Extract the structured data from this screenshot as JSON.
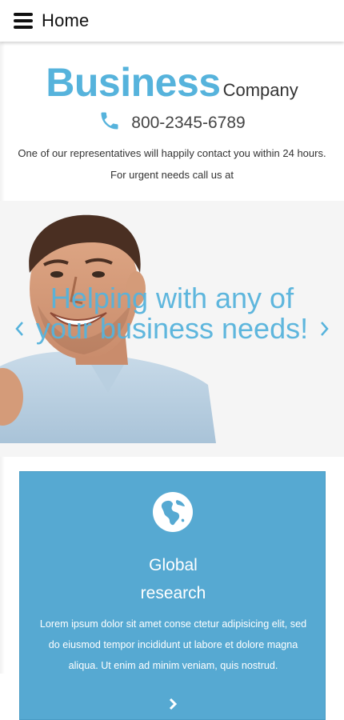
{
  "header": {
    "menu_icon": "hamburger-menu-icon",
    "title": "Home"
  },
  "brand": {
    "name": "Business",
    "subtitle": "Company",
    "accent_color": "#56b3dc"
  },
  "contact": {
    "phone_icon": "phone-icon",
    "phone": "800-2345-6789",
    "note": "One of our representatives will happily contact you within 24 hours.",
    "urgent": "For urgent needs call us at"
  },
  "slider": {
    "caption": "Helping with any of your business needs!",
    "prev_icon": "chevron-left-icon",
    "next_icon": "chevron-right-icon"
  },
  "feature_card": {
    "icon": "globe-icon",
    "title_line1": "Global",
    "title_line2": "research",
    "text": "Lorem ipsum dolor sit amet conse ctetur adipisicing elit, sed do eiusmod tempor incididunt ut labore et dolore magna aliqua. Ut enim ad minim veniam, quis nostrud.",
    "more_icon": "chevron-right-icon",
    "background_color": "#56a9d2"
  }
}
